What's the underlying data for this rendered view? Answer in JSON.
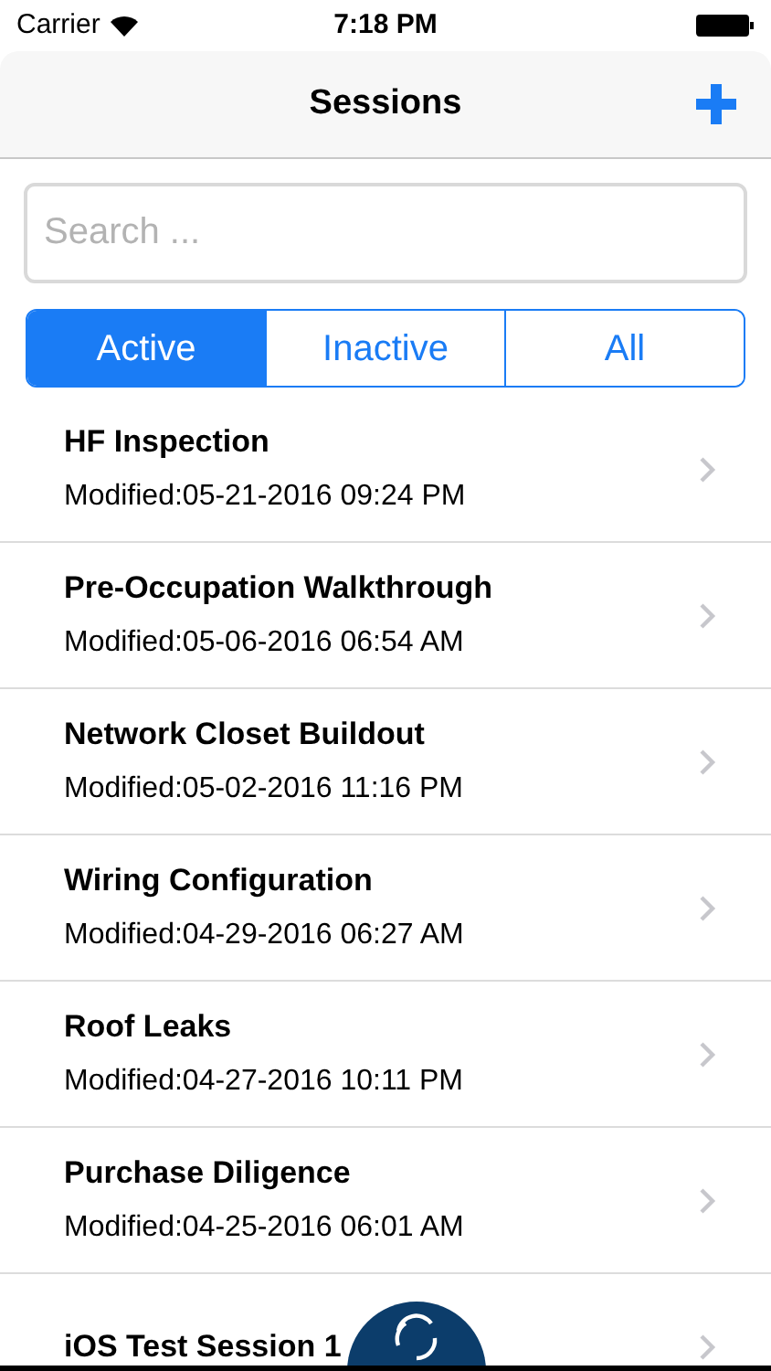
{
  "status_bar": {
    "carrier": "Carrier",
    "time": "7:18 PM"
  },
  "nav": {
    "title": "Sessions"
  },
  "search": {
    "placeholder": "Search ..."
  },
  "segments": [
    {
      "label": "Active",
      "selected": true
    },
    {
      "label": "Inactive",
      "selected": false
    },
    {
      "label": "All",
      "selected": false
    }
  ],
  "sessions": [
    {
      "title": "HF Inspection",
      "modified": "Modified:05-21-2016 09:24 PM"
    },
    {
      "title": "Pre-Occupation Walkthrough",
      "modified": "Modified:05-06-2016 06:54 AM"
    },
    {
      "title": "Network Closet Buildout",
      "modified": "Modified:05-02-2016 11:16 PM"
    },
    {
      "title": "Wiring Configuration",
      "modified": "Modified:04-29-2016 06:27 AM"
    },
    {
      "title": "Roof Leaks",
      "modified": "Modified:04-27-2016 10:11 PM"
    },
    {
      "title": "Purchase Diligence",
      "modified": "Modified:04-25-2016 06:01 AM"
    },
    {
      "title": "iOS Test Session 1"
    }
  ]
}
